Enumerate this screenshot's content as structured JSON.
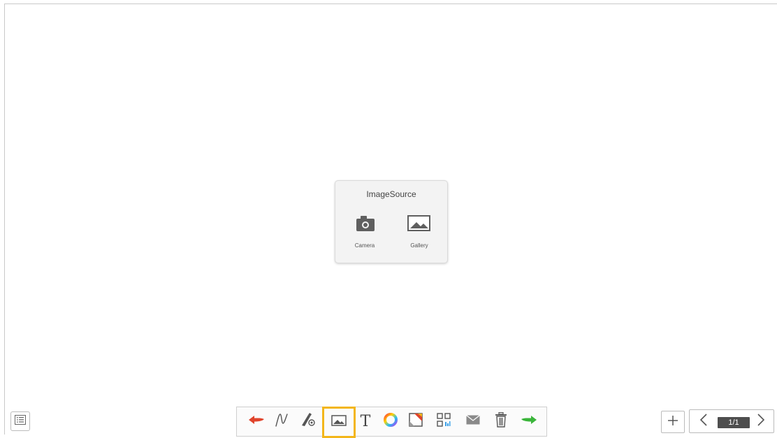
{
  "dialog": {
    "title": "ImageSource",
    "options": [
      {
        "label": "Camera",
        "icon": "camera-icon"
      },
      {
        "label": "Gallery",
        "icon": "image-icon"
      }
    ]
  },
  "toolbar": {
    "tools": [
      {
        "name": "undo",
        "icon": "undo-arrow-icon",
        "color": "#e0442c"
      },
      {
        "name": "pen",
        "icon": "pen-stroke-icon"
      },
      {
        "name": "pen-settings",
        "icon": "pen-settings-icon"
      },
      {
        "name": "image",
        "icon": "image-icon",
        "selected": true
      },
      {
        "name": "text",
        "icon": "text-icon",
        "glyph": "T"
      },
      {
        "name": "color",
        "icon": "color-wheel-icon"
      },
      {
        "name": "background",
        "icon": "background-icon"
      },
      {
        "name": "qr-code",
        "icon": "qr-code-icon"
      },
      {
        "name": "email",
        "icon": "envelope-icon"
      },
      {
        "name": "delete",
        "icon": "trash-icon"
      },
      {
        "name": "redo",
        "icon": "redo-arrow-icon",
        "color": "#3ab53a"
      }
    ],
    "selected_highlight_color": "#f3b61a"
  },
  "pager": {
    "page_indicator": "1/1"
  }
}
